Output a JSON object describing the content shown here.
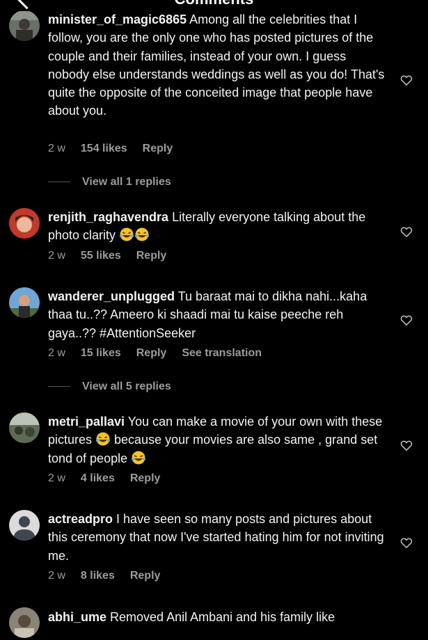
{
  "header": {
    "title": "Comments"
  },
  "comments": [
    {
      "username": "minister_of_magic6865",
      "text": " Among all the celebrities that I follow, you are the only one who has posted pictures of the couple and their families, instead of your own. I guess nobody else understands weddings as well as you do! That's quite the opposite of the conceited image that people have about you.",
      "age": "2 w",
      "likes": "154 likes",
      "reply": "Reply",
      "view_replies": "View all 1 replies"
    },
    {
      "username": "renjith_raghavendra",
      "text": " Literally everyone talking about the photo clarity",
      "age": "2 w",
      "likes": "55 likes",
      "reply": "Reply"
    },
    {
      "username": "wanderer_unplugged",
      "text": " Tu baraat mai to dikha nahi...kaha thaa tu..?? Ameero ki shaadi mai tu kaise peeche reh gaya..?? #AttentionSeeker",
      "age": "2 w",
      "likes": "15 likes",
      "reply": "Reply",
      "translation": "See translation",
      "view_replies": "View all 5 replies"
    },
    {
      "username": "metri_pallavi",
      "text_a": " You can make a movie of your own with these pictures ",
      "text_b": " because your movies are also same , grand set tond of people ",
      "age": "2 w",
      "likes": "4 likes",
      "reply": "Reply"
    },
    {
      "username": "actreadpro",
      "text": " I have seen so many posts and pictures about this ceremony that now I've started hating him for not inviting me.",
      "age": "2 w",
      "likes": "8 likes",
      "reply": "Reply"
    },
    {
      "username": "abhi_ume",
      "text": " Removed Anil Ambani and his family like"
    }
  ],
  "icons": {
    "like": "heart-outline-icon",
    "emoji": "face-with-tears-of-joy-emoji"
  },
  "colors": {
    "background": "#000000",
    "text": "#f3f3f3",
    "muted": "#9c9c9c",
    "emoji": "#f7c325"
  }
}
